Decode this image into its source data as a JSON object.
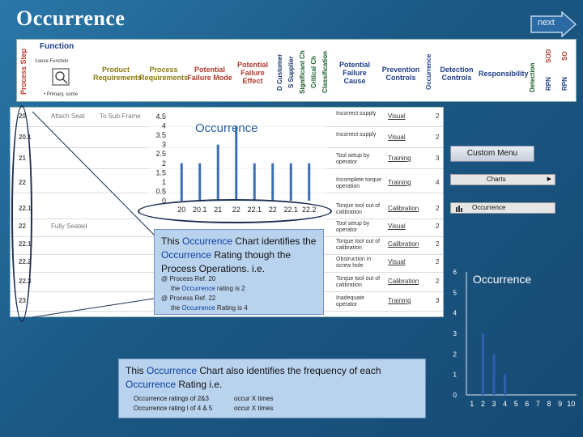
{
  "title": "Occurrence",
  "next_label": "next",
  "header": {
    "process_step": "Process Step",
    "function": "Function",
    "function_sub": "Loose Function",
    "function_foot": "• Primary, some",
    "product": "Product Requirements",
    "process": "Process Requirements",
    "pfm": "Potential Failure Mode",
    "pfe": "Potential Failure Effect",
    "d_customer": "D Customer",
    "s_supplier": "S Supplier",
    "significant": "Significant Ch",
    "critical": "Critical Ch",
    "classification": "Classification",
    "cause": "Potential Failure Cause",
    "prevention": "Prevention Controls",
    "occurrence": "Occurrence",
    "detection_controls": "Detection Controls",
    "responsibility": "Responsibility",
    "detection": "Detection",
    "rpn": "RPN",
    "sod": "SOD",
    "rpn2": "RPN",
    "so": "SO"
  },
  "rows": [
    {
      "ref": "20",
      "name": "Attach Seat",
      "desc": "To Sub-Frame",
      "cause": "Incorrect supply",
      "ctrl": "Visual",
      "occ": "2"
    },
    {
      "ref": "20.1",
      "name": "",
      "desc": "",
      "cause": "Incorrect supply",
      "ctrl": "Visual",
      "occ": "2"
    },
    {
      "ref": "21",
      "name": "",
      "desc": "",
      "cause": "Tool setup by operator",
      "ctrl": "Training",
      "occ": "3"
    },
    {
      "ref": "22",
      "name": "",
      "desc": "",
      "cause": "Incomplete torque operation",
      "ctrl": "Training",
      "occ": "4"
    },
    {
      "ref": "22.1",
      "name": "",
      "desc": "",
      "cause": "Torque tool out of calibration",
      "ctrl": "Calibration",
      "occ": "2"
    },
    {
      "ref": "22",
      "name": "Fully Seated",
      "desc": "",
      "cause": "Tool setup by operator",
      "ctrl": "Visual",
      "occ": "2"
    },
    {
      "ref": "22.1",
      "name": "",
      "desc": "",
      "cause": "Torque tool out of calibration",
      "ctrl": "Calibration",
      "occ": "2"
    },
    {
      "ref": "22.2",
      "name": "",
      "desc": "",
      "cause": "Obstruction in screw hole",
      "ctrl": "Visual",
      "occ": "2"
    },
    {
      "ref": "22.3",
      "name": "",
      "desc": "",
      "cause": "Torque tool out of calibration",
      "ctrl": "Calibration",
      "occ": "2"
    },
    {
      "ref": "23",
      "name": "",
      "desc": "",
      "cause": "Inadequate operator",
      "ctrl": "Training",
      "occ": "3"
    }
  ],
  "chart1_title": "Occurrence",
  "chart_data": [
    {
      "type": "bar",
      "title": "Occurrence",
      "categories": [
        "20",
        "20.1",
        "21",
        "22",
        "22.1",
        "22",
        "22.1",
        "22.2"
      ],
      "values": [
        2,
        2,
        3,
        4,
        2,
        2,
        2,
        2
      ],
      "yticks": [
        "4.5",
        "4",
        "3.5",
        "3",
        "2.5",
        "2",
        "1.5",
        "1",
        "0.5",
        "0"
      ],
      "ylim": [
        0,
        4.5
      ],
      "xlabel": "",
      "ylabel": ""
    },
    {
      "type": "bar",
      "title": "Occurrence",
      "categories": [
        "1",
        "2",
        "3",
        "4",
        "5",
        "6",
        "7",
        "8",
        "9",
        "10"
      ],
      "values": [
        0,
        3,
        2,
        1,
        0,
        0,
        0,
        0,
        0,
        0
      ],
      "yticks": [
        "6",
        "5",
        "4",
        "3",
        "2",
        "1",
        "0"
      ],
      "ylim": [
        0,
        6
      ],
      "xlabel": "",
      "ylabel": ""
    }
  ],
  "callout1": {
    "lead_pre": "This ",
    "lead_b1": "Occurrence",
    "lead_mid": " Chart identifies the ",
    "lead_b2": "Occurrence",
    "lead_post": " Rating though the Process Operations. i.e.",
    "l1": "@ Process Ref. 20",
    "l2_pre": "the ",
    "l2_b": "Occurrence",
    "l2_post": " rating is 2",
    "l3": "@ Process Ref. 22",
    "l4_pre": "the ",
    "l4_b": "Occurrence",
    "l4_post": " Rating is 4"
  },
  "callout2": {
    "lead_pre": "This ",
    "lead_b": "Occurrence",
    "lead_mid": " Chart also identifies the frequency of each ",
    "lead_b2": "Occurrence",
    "lead_post": " Rating i.e.",
    "r1a": "Occurrence ratings of 2&3",
    "r1b": "occur X times",
    "r2a": "Occurrence rating l of 4 & 5",
    "r2b": "occur X times"
  },
  "menu": {
    "custom": "Custom Menu",
    "charts": "Charts",
    "occurrence": "Occurrence"
  },
  "colors": {
    "background": "#1f5a85",
    "bar": "#3a6fb5",
    "callout": "#b9d3ef"
  }
}
